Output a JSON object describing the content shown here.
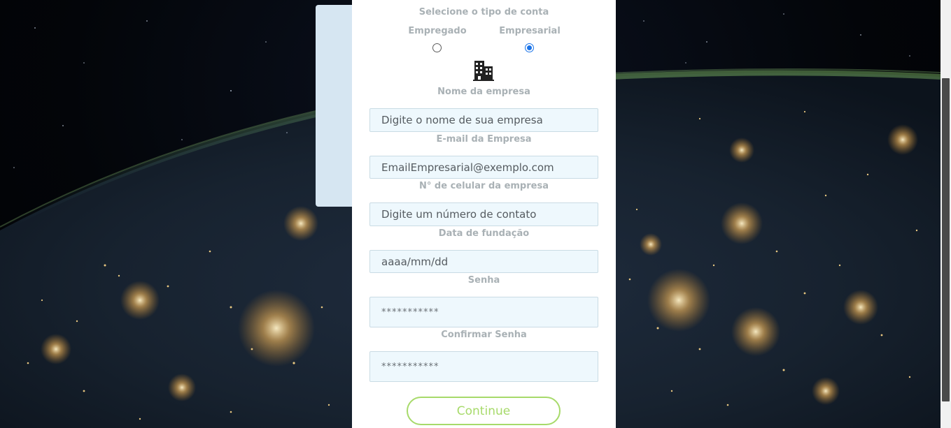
{
  "form": {
    "account_type_title": "Selecione o tipo de conta",
    "account_types": [
      {
        "label": "Empregado",
        "selected": false
      },
      {
        "label": "Empresarial",
        "selected": true
      }
    ],
    "icon": "building-icon",
    "fields": {
      "company_name": {
        "label": "Nome da empresa",
        "placeholder": "Digite o nome de sua empresa"
      },
      "company_email": {
        "label": "E-mail da Empresa",
        "placeholder": "EmailEmpresarial@exemplo.com"
      },
      "company_phone": {
        "label": "N° de celular da empresa",
        "placeholder": "Digite um número de contato"
      },
      "founding_date": {
        "label": "Data de fundação",
        "placeholder": "aaaa/mm/dd"
      },
      "password": {
        "label": "Senha",
        "placeholder": "***********"
      },
      "confirm_password": {
        "label": "Confirmar Senha",
        "placeholder": "***********"
      }
    },
    "continue_label": "Continue"
  },
  "colors": {
    "label_gray": "#a9b1b5",
    "field_bg": "#eef8fd",
    "accent_green": "#a7da6a",
    "radio_blue": "#1a73e8",
    "back_card": "#d6e6f2"
  }
}
